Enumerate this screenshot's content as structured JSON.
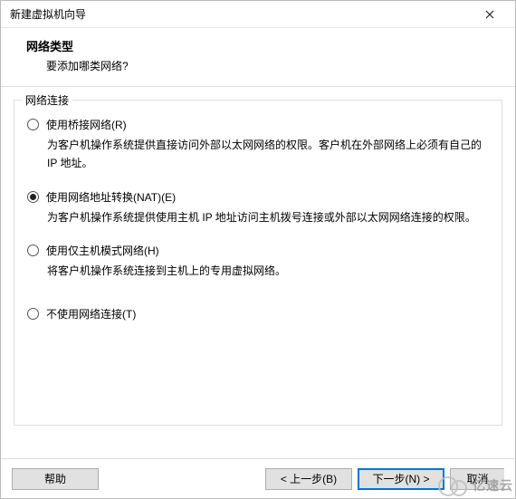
{
  "titlebar": {
    "title": "新建虚拟机向导"
  },
  "header": {
    "title": "网络类型",
    "subtitle": "要添加哪类网络?"
  },
  "group": {
    "legend": "网络连接",
    "options": [
      {
        "label": "使用桥接网络(R)",
        "desc": "为客户机操作系统提供直接访问外部以太网网络的权限。客户机在外部网络上必须有自己的 IP 地址。",
        "checked": false
      },
      {
        "label": "使用网络地址转换(NAT)(E)",
        "desc": "为客户机操作系统提供使用主机 IP 地址访问主机拨号连接或外部以太网网络连接的权限。",
        "checked": true
      },
      {
        "label": "使用仅主机模式网络(H)",
        "desc": "将客户机操作系统连接到主机上的专用虚拟网络。",
        "checked": false
      },
      {
        "label": "不使用网络连接(T)",
        "desc": "",
        "checked": false
      }
    ]
  },
  "footer": {
    "help": "帮助",
    "back": "< 上一步(B)",
    "next": "下一步(N) >",
    "cancel": "取消"
  },
  "watermark": {
    "text": "亿速云"
  }
}
